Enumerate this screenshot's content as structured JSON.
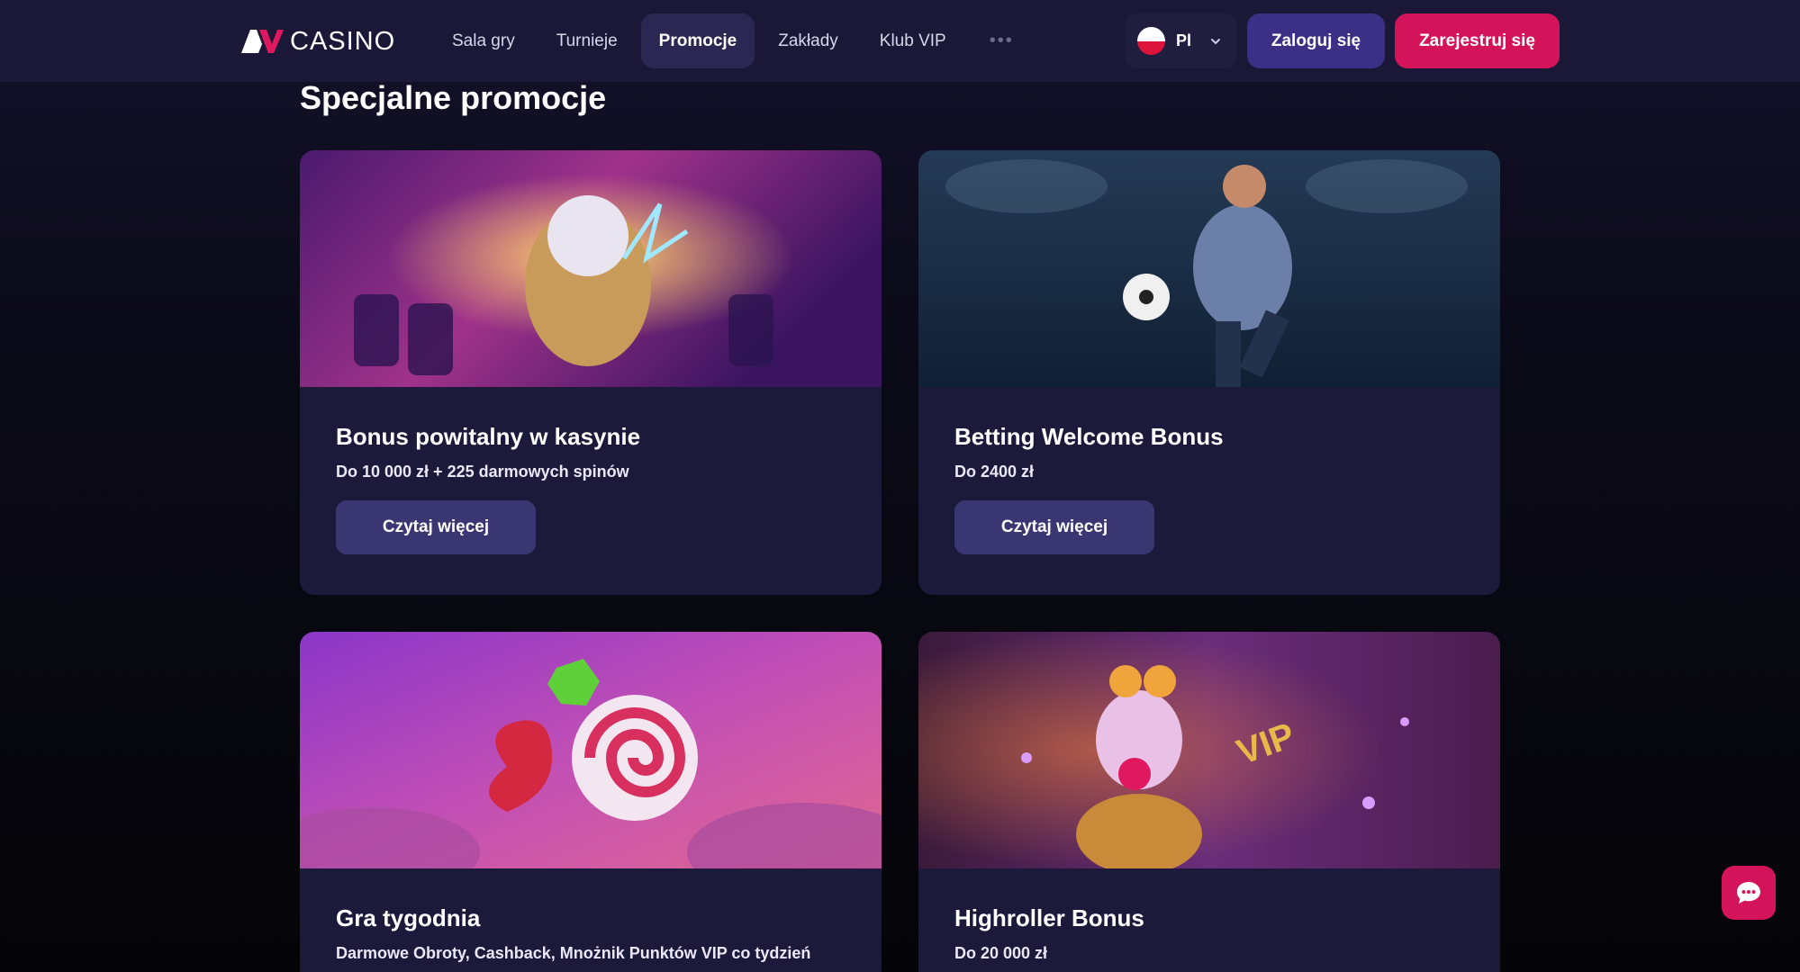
{
  "header": {
    "logo_text": "CASINO",
    "nav": [
      "Sala gry",
      "Turnieje",
      "Promocje",
      "Zakłady",
      "Klub VIP"
    ],
    "more": "•••",
    "lang": "Pl",
    "login": "Zaloguj się",
    "register": "Zarejestruj się"
  },
  "section": {
    "title": "Specjalne promocje"
  },
  "cards": [
    {
      "title": "Bonus powitalny w kasynie",
      "subtitle": "Do 10 000 zł + 225 darmowych spinów",
      "button": "Czytaj więcej"
    },
    {
      "title": "Betting Welcome Bonus",
      "subtitle": "Do 2400 zł",
      "button": "Czytaj więcej"
    },
    {
      "title": "Gra tygodnia",
      "subtitle": "Darmowe Obroty, Cashback, Mnożnik Punktów VIP co tydzień"
    },
    {
      "title": "Highroller Bonus",
      "subtitle": "Do 20 000 zł"
    }
  ],
  "colors": {
    "accent": "#d4145a",
    "login": "#3b2f86",
    "card": "#1b1a3a",
    "header": "#1a1836"
  },
  "icons": [
    "logo-mark-icon",
    "poland-flag-icon",
    "chevron-down-icon",
    "chat-icon"
  ]
}
